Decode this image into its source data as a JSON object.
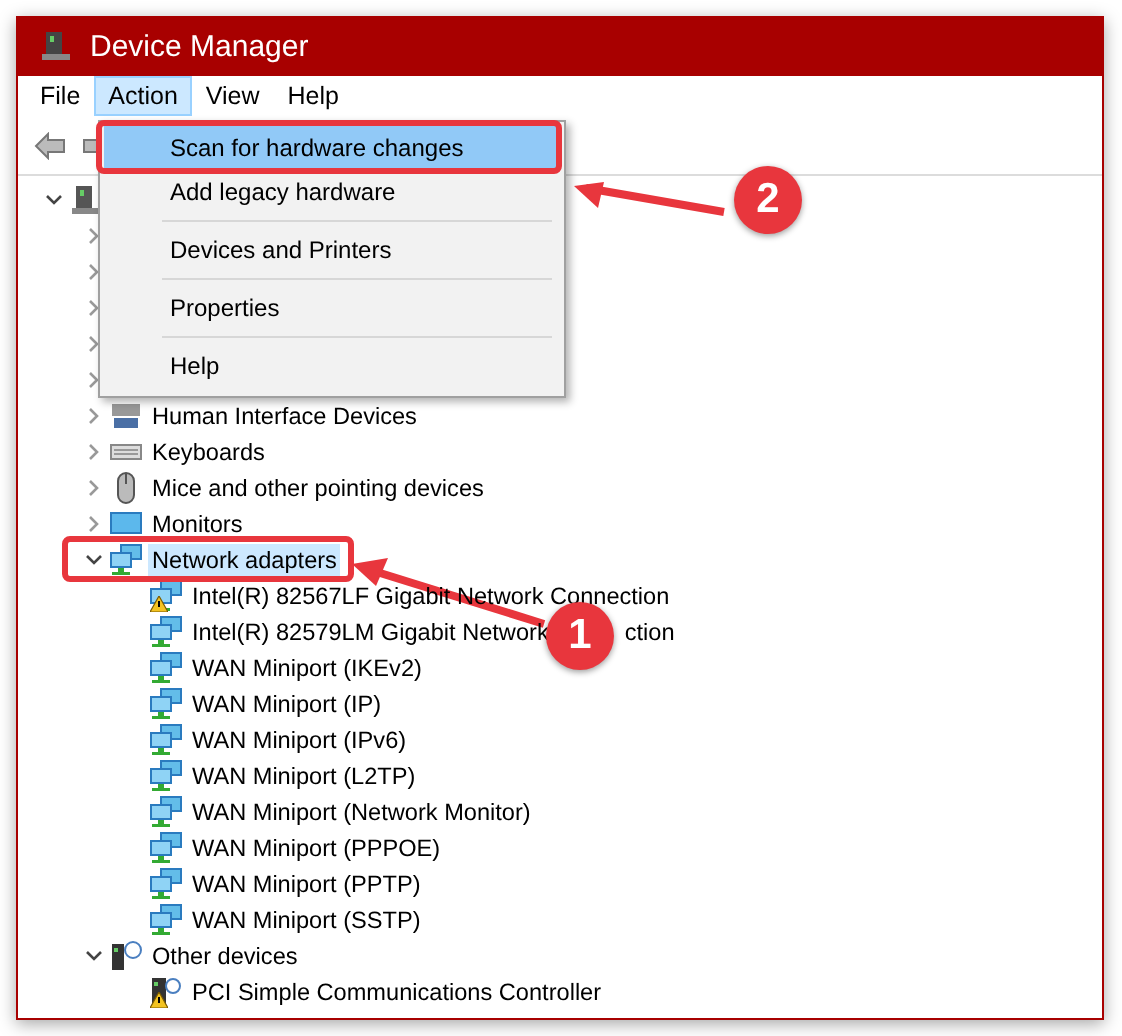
{
  "window": {
    "title": "Device Manager"
  },
  "menu_bar": [
    {
      "label": "File",
      "selected": false
    },
    {
      "label": "Action",
      "selected": true
    },
    {
      "label": "View",
      "selected": false
    },
    {
      "label": "Help",
      "selected": false
    }
  ],
  "action_menu": [
    {
      "kind": "item",
      "label": "Scan for hardware changes",
      "selected": true
    },
    {
      "kind": "item",
      "label": "Add legacy hardware",
      "selected": false
    },
    {
      "kind": "separator"
    },
    {
      "kind": "item",
      "label": "Devices and Printers",
      "selected": false
    },
    {
      "kind": "separator"
    },
    {
      "kind": "item",
      "label": "Properties",
      "selected": false
    },
    {
      "kind": "separator"
    },
    {
      "kind": "item",
      "label": "Help",
      "selected": false
    }
  ],
  "device_tree": {
    "kind": "computer",
    "expanded": true,
    "children": [
      {
        "kind": "hidden",
        "expanded": false
      },
      {
        "kind": "hidden",
        "expanded": false
      },
      {
        "kind": "hidden",
        "expanded": false
      },
      {
        "kind": "hidden",
        "expanded": false
      },
      {
        "kind": "hidden",
        "expanded": false
      },
      {
        "kind": "hid",
        "label": "Human Interface Devices",
        "expanded": false
      },
      {
        "kind": "keyboard",
        "label": "Keyboards",
        "expanded": false
      },
      {
        "kind": "mouse",
        "label": "Mice and other pointing devices",
        "expanded": false
      },
      {
        "kind": "monitor",
        "label": "Monitors",
        "expanded": false
      },
      {
        "kind": "network",
        "label": "Network adapters",
        "expanded": true,
        "highlighted": true,
        "children": [
          {
            "kind": "network",
            "label": "Intel(R) 82567LF Gigabit Network Connection",
            "warning": true
          },
          {
            "kind": "network",
            "label": "Intel(R) 82579LM Gigabit Network",
            "label_end": "ction",
            "warning": false
          },
          {
            "kind": "network",
            "label": "WAN Miniport (IKEv2)",
            "warning": false
          },
          {
            "kind": "network",
            "label": "WAN Miniport (IP)",
            "warning": false
          },
          {
            "kind": "network",
            "label": "WAN Miniport (IPv6)",
            "warning": false
          },
          {
            "kind": "network",
            "label": "WAN Miniport (L2TP)",
            "warning": false
          },
          {
            "kind": "network",
            "label": "WAN Miniport (Network Monitor)",
            "warning": false
          },
          {
            "kind": "network",
            "label": "WAN Miniport (PPPOE)",
            "warning": false
          },
          {
            "kind": "network",
            "label": "WAN Miniport (PPTP)",
            "warning": false
          },
          {
            "kind": "network",
            "label": "WAN Miniport (SSTP)",
            "warning": false
          }
        ]
      },
      {
        "kind": "other",
        "label": "Other devices",
        "expanded": true,
        "children": [
          {
            "kind": "unknown",
            "label": "PCI Simple Communications Controller",
            "warning": true
          }
        ]
      }
    ]
  },
  "callouts": [
    {
      "number": "1"
    },
    {
      "number": "2"
    }
  ]
}
